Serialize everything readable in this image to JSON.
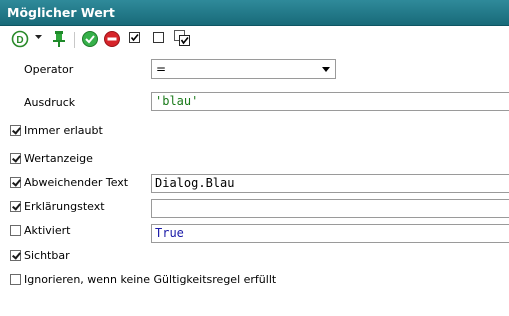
{
  "window": {
    "title": "Möglicher Wert"
  },
  "toolbar": {
    "icons": [
      "d-circle-icon",
      "dropdown-arrow-icon",
      "pin-icon",
      "check-circle-icon",
      "minus-circle-icon",
      "checkbox-checked-icon",
      "checkbox-unchecked-icon",
      "checkbox-stack-icon"
    ]
  },
  "form": {
    "operator_label": "Operator",
    "operator_value": "=",
    "expression_label": "Ausdruck",
    "expression_value": "'blau'",
    "expression_color": "#1a7a1a"
  },
  "options": [
    {
      "label": "Immer erlaubt",
      "checked": true
    },
    {
      "label": "Wertanzeige",
      "checked": true
    },
    {
      "label": "Abweichender Text",
      "checked": true,
      "value": "Dialog.Blau",
      "value_color": "#000000"
    },
    {
      "label": "Erklärungstext",
      "checked": true,
      "value": ""
    },
    {
      "label": "Aktiviert",
      "checked": false,
      "value": "True",
      "value_color": "#1a1aa8"
    },
    {
      "label": "Sichtbar",
      "checked": true
    },
    {
      "label": "Ignorieren, wenn keine Gültigkeitsregel erfüllt",
      "checked": false
    }
  ]
}
